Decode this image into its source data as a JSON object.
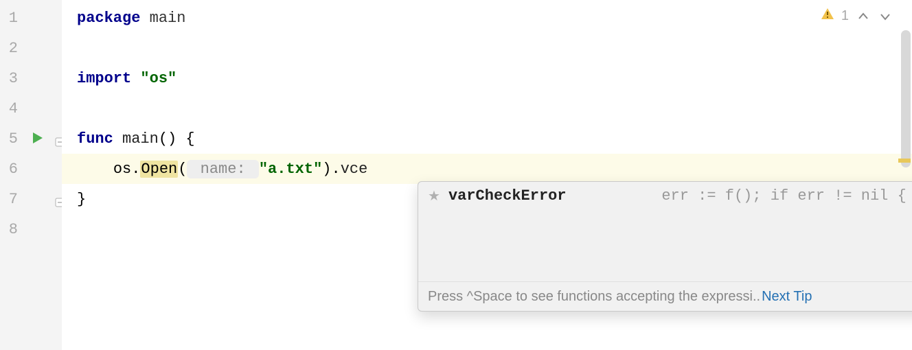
{
  "lines": {
    "l1": "1",
    "l2": "2",
    "l3": "3",
    "l4": "4",
    "l5": "5",
    "l6": "6",
    "l7": "7",
    "l8": "8"
  },
  "code": {
    "package_kw": "package",
    "package_name": " main",
    "import_kw": "import",
    "import_path": " \"os\"",
    "func_kw": "func",
    "func_name": " main",
    "func_parens": "()",
    "brace_open": " {",
    "indent6": "    ",
    "os_ident": "os",
    "dot1": ".",
    "open_ident": "Open",
    "open_paren": "(",
    "hint_name": " name: ",
    "arg_str": "\"a.txt\"",
    "close_paren": ")",
    "dot2": ".",
    "postfix": "vce",
    "brace_close": "}"
  },
  "indicators": {
    "warning_count": "1"
  },
  "completion": {
    "name": "varCheckError",
    "signature": "err := f(); if err != nil { retu…"
  },
  "footer": {
    "hint": "Press ^Space to see functions accepting the expressi..",
    "next_tip": "Next Tip"
  }
}
